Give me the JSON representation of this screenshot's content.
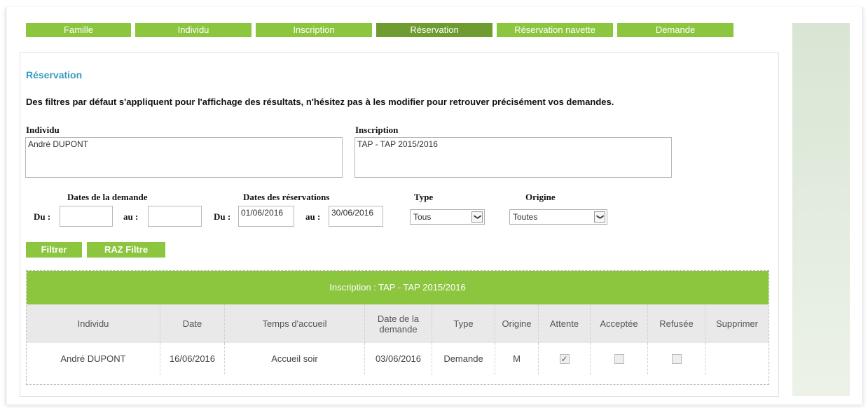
{
  "tabs": [
    {
      "label": "Famille"
    },
    {
      "label": "Individu"
    },
    {
      "label": "Inscription"
    },
    {
      "label": "Réservation",
      "active": true
    },
    {
      "label": "Réservation navette"
    },
    {
      "label": "Demande"
    }
  ],
  "section_title": "Réservation",
  "intro": "Des filtres par défaut s'appliquent pour l'affichage des résultats, n'hésitez pas à les modifier pour retrouver précisément vos demandes.",
  "filters": {
    "individu_label": "Individu",
    "individu_value": "André DUPONT",
    "inscription_label": "Inscription",
    "inscription_value": "TAP - TAP 2015/2016",
    "dates_demande_label": "Dates de la demande",
    "dates_reservations_label": "Dates des réservations",
    "du_label": "Du :",
    "au_label": "au :",
    "demande_du": "",
    "demande_au": "",
    "reservation_du": "01/06/2016",
    "reservation_au": "30/06/2016",
    "type_label": "Type",
    "type_value": "Tous",
    "origine_label": "Origine",
    "origine_value": "Toutes",
    "select_arrow": "❯"
  },
  "buttons": {
    "filtrer": "Filtrer",
    "raz": "RAZ Filtre"
  },
  "table": {
    "group_title": "Inscription : TAP - TAP 2015/2016",
    "columns": [
      "Individu",
      "Date",
      "Temps d'accueil",
      "Date de la demande",
      "Type",
      "Origine",
      "Attente",
      "Acceptée",
      "Refusée",
      "Supprimer"
    ],
    "rows": [
      {
        "individu": "André DUPONT",
        "date": "16/06/2016",
        "temps": "Accueil soir",
        "date_demande": "03/06/2016",
        "type": "Demande",
        "origine": "M",
        "attente": true,
        "acceptee": false,
        "refusee": false,
        "check_glyph": "✓"
      }
    ]
  },
  "colors": {
    "tab_green": "#8cc63f",
    "tab_active": "#6e9c30",
    "title_blue": "#3a9cc0"
  }
}
